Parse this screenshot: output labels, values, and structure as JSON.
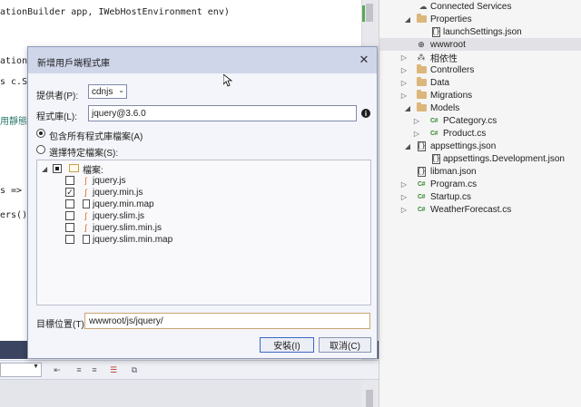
{
  "editor": {
    "lines": [
      "ationBuilder app, IWebHostEnvironment env)",
      "ationP",
      "s c.Sw",
      "用靜態",
      "s =>",
      "ers()"
    ]
  },
  "solution_explorer": {
    "items": [
      {
        "label": "Connected Services",
        "icon": "connected-services-icon",
        "arrow": ""
      },
      {
        "label": "Properties",
        "icon": "folder-icon",
        "arrow": "◢"
      },
      {
        "label": "launchSettings.json",
        "icon": "json-file-icon",
        "arrow": ""
      },
      {
        "label": "wwwroot",
        "icon": "globe-icon",
        "arrow": ""
      },
      {
        "label": "相依性",
        "icon": "dependencies-icon",
        "arrow": "▷"
      },
      {
        "label": "Controllers",
        "icon": "folder-icon",
        "arrow": "▷"
      },
      {
        "label": "Data",
        "icon": "folder-icon",
        "arrow": "▷"
      },
      {
        "label": "Migrations",
        "icon": "folder-icon",
        "arrow": "▷"
      },
      {
        "label": "Models",
        "icon": "folder-icon",
        "arrow": "◢"
      },
      {
        "label": "PCategory.cs",
        "icon": "csharp-file-icon",
        "arrow": "▷"
      },
      {
        "label": "Product.cs",
        "icon": "csharp-file-icon",
        "arrow": "▷"
      },
      {
        "label": "appsettings.json",
        "icon": "json-file-icon",
        "arrow": "◢"
      },
      {
        "label": "appsettings.Development.json",
        "icon": "json-file-icon",
        "arrow": ""
      },
      {
        "label": "libman.json",
        "icon": "json-file-icon",
        "arrow": ""
      },
      {
        "label": "Program.cs",
        "icon": "csharp-file-icon",
        "arrow": "▷"
      },
      {
        "label": "Startup.cs",
        "icon": "csharp-file-icon",
        "arrow": "▷"
      },
      {
        "label": "WeatherForecast.cs",
        "icon": "csharp-file-icon",
        "arrow": "▷"
      }
    ]
  },
  "dialog": {
    "title": "新增用戶端程式庫",
    "close_glyph": "✕",
    "provider_label": "提供者(P):",
    "provider_value": "cdnjs",
    "library_label": "程式庫(L):",
    "library_value": "jquery@3.6.0",
    "info_glyph": "i",
    "include_all_label": "包含所有程式庫檔案(A)",
    "choose_specific_label": "選擇特定檔案(S):",
    "include_all_checked": true,
    "files_root_label": "檔案:",
    "files": [
      {
        "name": "jquery.js",
        "checked": false,
        "type": "js"
      },
      {
        "name": "jquery.min.js",
        "checked": true,
        "type": "js"
      },
      {
        "name": "jquery.min.map",
        "checked": false,
        "type": "map"
      },
      {
        "name": "jquery.slim.js",
        "checked": false,
        "type": "js"
      },
      {
        "name": "jquery.slim.min.js",
        "checked": false,
        "type": "js"
      },
      {
        "name": "jquery.slim.min.map",
        "checked": false,
        "type": "map"
      }
    ],
    "target_label": "目標位置(T):",
    "target_value": "wwwroot/js/jquery/",
    "install_label": "安裝(I)",
    "cancel_label": "取消(C)"
  },
  "colors": {
    "dialog_titlebar": "#cfd6ea",
    "editor_dark_strip": "#3b4460",
    "csharp_icon": "#388a34",
    "js_icon": "#e06c2a",
    "folder": "#dcb67a"
  }
}
